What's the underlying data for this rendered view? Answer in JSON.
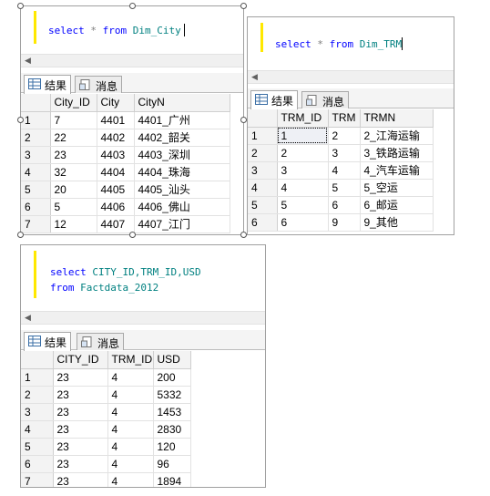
{
  "tabs": {
    "results": "结果",
    "messages": "消息"
  },
  "pane_city": {
    "sql": {
      "kw1": "select",
      "op": "*",
      "kw2": "from",
      "table": "Dim_City"
    },
    "columns": [
      "City_ID",
      "City",
      "CityN"
    ],
    "rows": [
      [
        "1",
        "7",
        "4401",
        "4401_广州"
      ],
      [
        "2",
        "22",
        "4402",
        "4402_韶关"
      ],
      [
        "3",
        "23",
        "4403",
        "4403_深圳"
      ],
      [
        "4",
        "32",
        "4404",
        "4404_珠海"
      ],
      [
        "5",
        "20",
        "4405",
        "4405_汕头"
      ],
      [
        "6",
        "5",
        "4406",
        "4406_佛山"
      ],
      [
        "7",
        "12",
        "4407",
        "4407_江门"
      ]
    ]
  },
  "pane_trm": {
    "sql": {
      "kw1": "select",
      "op": "*",
      "kw2": "from",
      "table": "Dim_TRM"
    },
    "columns": [
      "TRM_ID",
      "TRM",
      "TRMN"
    ],
    "rows": [
      [
        "1",
        "1",
        "2",
        "2_江海运输"
      ],
      [
        "2",
        "2",
        "3",
        "3_铁路运输"
      ],
      [
        "3",
        "3",
        "4",
        "4_汽车运输"
      ],
      [
        "4",
        "4",
        "5",
        "5_空运"
      ],
      [
        "5",
        "5",
        "6",
        "6_邮运"
      ],
      [
        "6",
        "6",
        "9",
        "9_其他"
      ]
    ]
  },
  "pane_fact": {
    "sql": {
      "kw1": "select",
      "cols": "CITY_ID,TRM_ID,USD",
      "kw2": "from",
      "table": "Factdata_2012"
    },
    "columns": [
      "CITY_ID",
      "TRM_ID",
      "USD"
    ],
    "rows": [
      [
        "1",
        "23",
        "4",
        "200"
      ],
      [
        "2",
        "23",
        "4",
        "5332"
      ],
      [
        "3",
        "23",
        "4",
        "1453"
      ],
      [
        "4",
        "23",
        "4",
        "2830"
      ],
      [
        "5",
        "23",
        "4",
        "120"
      ],
      [
        "6",
        "23",
        "4",
        "96"
      ],
      [
        "7",
        "23",
        "4",
        "1894"
      ]
    ]
  },
  "icons": {
    "results_tab": "grid-icon",
    "messages_tab": "message-icon",
    "scroll_left": "left-arrow-icon"
  },
  "colors": {
    "keyword": "#0000ff",
    "identifier": "#008080",
    "operator": "#808080",
    "editor_margin": "#ffe800"
  }
}
